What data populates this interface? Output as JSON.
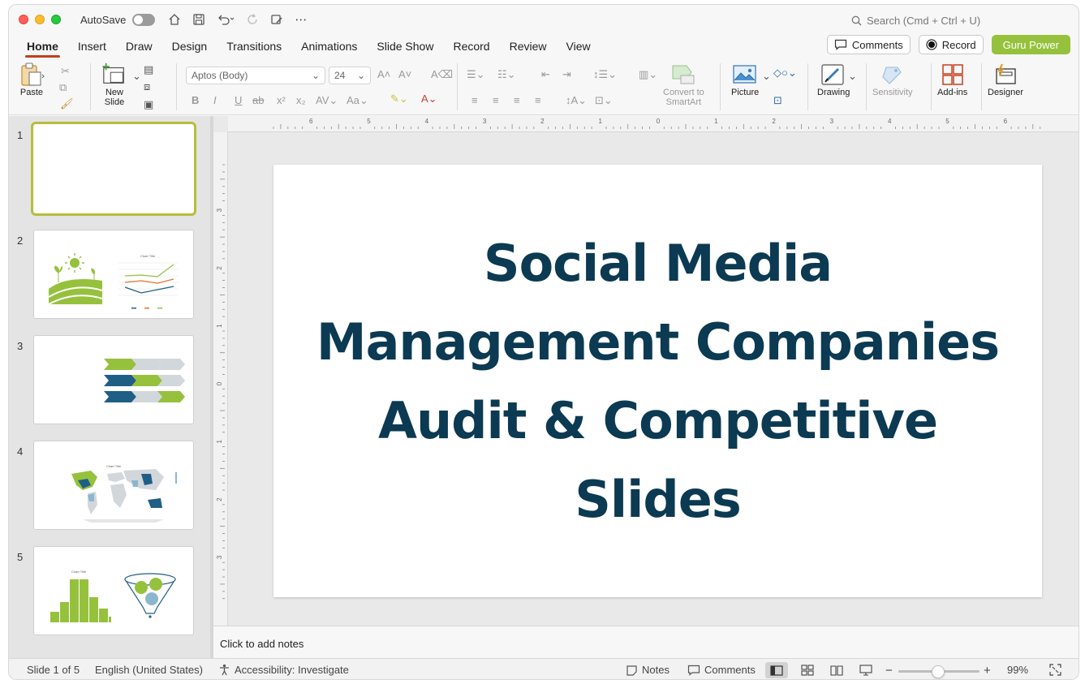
{
  "titlebar": {
    "autosave_label": "AutoSave",
    "search_placeholder": "Search (Cmd + Ctrl + U)"
  },
  "menu": {
    "tabs": [
      "Home",
      "Insert",
      "Draw",
      "Design",
      "Transitions",
      "Animations",
      "Slide Show",
      "Record",
      "Review",
      "View"
    ],
    "active": "Home",
    "comments_label": "Comments",
    "record_label": "Record",
    "guru_label": "Guru Power"
  },
  "ribbon": {
    "paste": "Paste",
    "new_slide_line1": "New",
    "new_slide_line2": "Slide",
    "font_name": "Aptos (Body)",
    "font_size": "24",
    "convert_line1": "Convert to",
    "convert_line2": "SmartArt",
    "picture": "Picture",
    "drawing": "Drawing",
    "sensitivity": "Sensitivity",
    "addins": "Add-ins",
    "designer": "Designer"
  },
  "thumbnails": {
    "numbers": [
      "1",
      "2",
      "3",
      "4",
      "5"
    ],
    "chart_title": "Chart Title",
    "selected": 1
  },
  "slide": {
    "title_line1": "Social Media",
    "title_line2": "Management Companies",
    "title_line3": "Audit & Competitive",
    "title_line4": "Slides"
  },
  "ruler": {
    "top_labels": [
      "6",
      "5",
      "4",
      "3",
      "2",
      "1",
      "0",
      "1",
      "2",
      "3",
      "4",
      "5",
      "6"
    ],
    "left_labels": [
      "3",
      "2",
      "1",
      "0",
      "1",
      "2",
      "3"
    ]
  },
  "notes": {
    "placeholder": "Click to add notes"
  },
  "status": {
    "slide_count": "Slide 1 of 5",
    "language": "English (United States)",
    "accessibility": "Accessibility: Investigate",
    "notes_label": "Notes",
    "comments_label": "Comments",
    "zoom": "99%"
  },
  "colors": {
    "accent_green": "#96c13d",
    "title_navy": "#0b3a52",
    "active_tab_red": "#c43e1c",
    "thumb_blue": "#1f5f86",
    "thumb_grey": "#d2d7dc"
  }
}
